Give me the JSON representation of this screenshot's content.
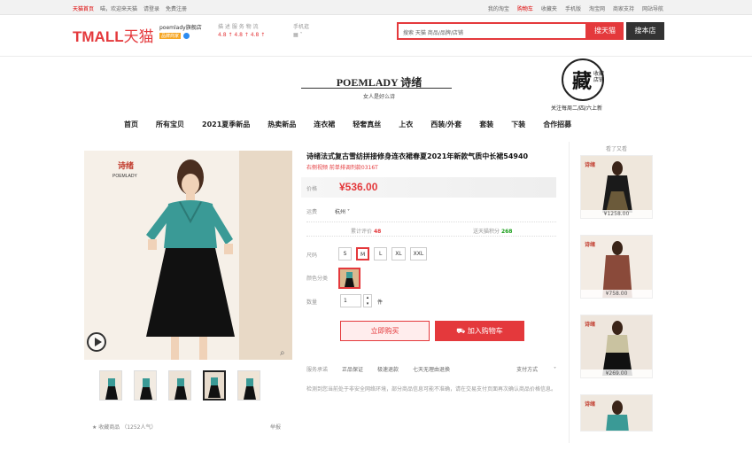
{
  "topbar": {
    "left": [
      "天猫首页",
      "喵，欢迎来天猫",
      "请登录",
      "免费注册"
    ],
    "right": [
      "我的淘宝",
      "购物车",
      "收藏夹",
      "手机版",
      "淘宝网",
      "商家支持",
      "网站导航"
    ]
  },
  "header": {
    "logo": "TMALL",
    "logo_cn": "天猫",
    "shop_name": "poemlady旗舰店",
    "shop_tag": "品牌商家",
    "rating_label": "描 述  服 务  物 流",
    "rating_values": "4.8 ↑  4.8 ↑  4.8 ↑",
    "phone_label": "手机逛",
    "search_placeholder": "搜索 天猫 商品/品牌/店铺",
    "search_tmall": "搜天猫",
    "search_shop": "搜本店"
  },
  "brand": {
    "en": "POEMLADY 诗绪",
    "cn": "女人是好么诗"
  },
  "fav": {
    "big": "藏",
    "small": "收藏 店铺",
    "note": "关注每周二/四/六上新"
  },
  "nav": [
    "首页",
    "所有宝贝",
    "2021夏季新品",
    "热卖新品",
    "连衣裙",
    "轻奢真丝",
    "上衣",
    "西装/外套",
    "套装",
    "下装",
    "合作招募"
  ],
  "product": {
    "title": "诗绪法式复古雪纺拼接修身连衣裙春夏2021年新款气质中长裙54940",
    "subtitle": "右侧视频 前单排调剂款0316T",
    "price_label": "价格",
    "price": "¥536.00",
    "ship_label": "运费",
    "ship_value": "杭州",
    "reviews_label": "累计评价",
    "reviews_count": "48",
    "points_label": "送天猫积分",
    "points_count": "268",
    "size_label": "尺码",
    "sizes": [
      "S",
      "M",
      "L",
      "XL",
      "XXL"
    ],
    "color_label": "颜色分类",
    "qty_label": "数量",
    "qty_value": "1",
    "qty_unit": "件",
    "buy_now": "立即购买",
    "add_cart": "加入购物车",
    "service_label": "服务承诺",
    "services": [
      "正品保证",
      "极速退款",
      "七天无理由退换"
    ],
    "pay": "支付方式",
    "note": "检测到您当前处于非安全网络环境，部分商品信息可能不准确，请在交易支付页面再次确认商品价格信息。"
  },
  "gallery": {
    "collect": "收藏商品 （1252人气）",
    "report": "举报"
  },
  "sidebar": {
    "title": "看了又看",
    "items": [
      "¥1258.00",
      "¥758.00",
      "¥269.00",
      ""
    ]
  },
  "colors": {
    "accent": "#e4393c",
    "teal": "#2f8f8a"
  }
}
